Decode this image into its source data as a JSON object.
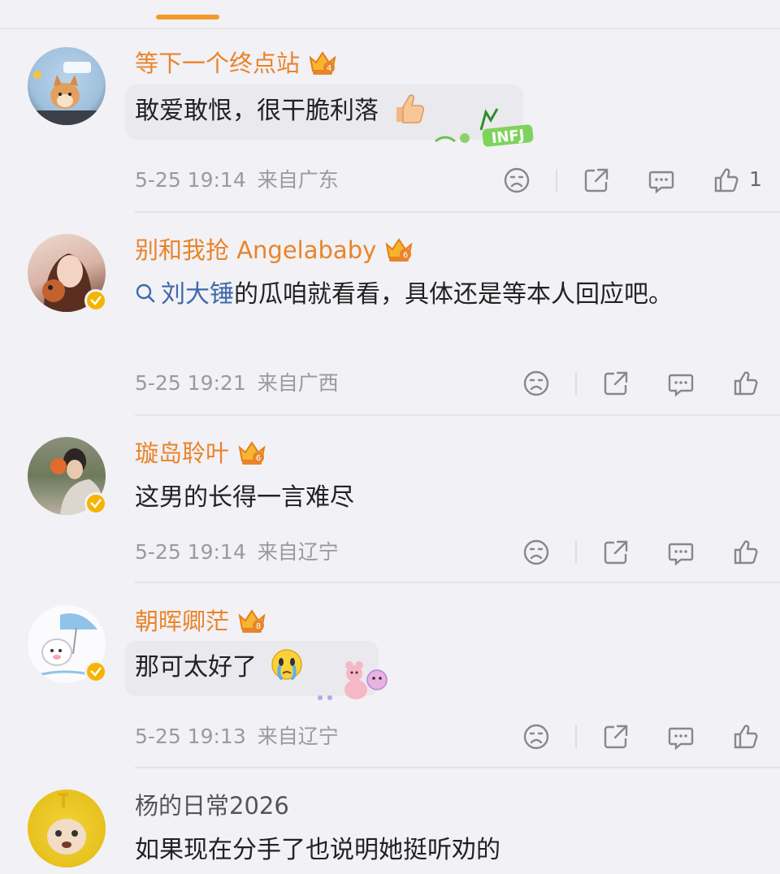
{
  "comments": [
    {
      "username": "等下一个终点站",
      "username_style": "vip",
      "crown_level": "4",
      "text": "敢爱敢恨，很干脆利落",
      "inline_emoji": "thumbs-up",
      "sticker_text": "INFJ",
      "time": "5-25 19:14",
      "location": "来自广东",
      "like_count": "1"
    },
    {
      "username": "别和我抢 Angelababy",
      "username_style": "vip",
      "crown_level": "6",
      "search_term": "刘大锤",
      "text": "的瓜咱就看看，具体还是等本人回应吧。",
      "time": "5-25 19:21",
      "location": "来自广西",
      "like_count": ""
    },
    {
      "username": "璇岛聆叶",
      "username_style": "vip",
      "crown_level": "6",
      "text": "这男的长得一言难尽",
      "time": "5-25 19:14",
      "location": "来自辽宁",
      "like_count": ""
    },
    {
      "username": "朝晖卿茫",
      "username_style": "vip",
      "crown_level": "8",
      "text": "那可太好了",
      "inline_emoji": "crying-face",
      "time": "5-25 19:13",
      "location": "来自辽宁",
      "like_count": ""
    },
    {
      "username": "杨的日常2026",
      "username_style": "plain",
      "text": "如果现在分手了也说明她挺听劝的"
    }
  ],
  "colors": {
    "background": "#f2f1f5",
    "vip_name": "#e9842a",
    "tab_indicator": "#f39a2b",
    "link": "#3f6aa8",
    "meta": "#9a9a9f",
    "verified": "#f5b400"
  },
  "icons": {
    "dislike": "sad-face-icon",
    "share": "share-icon",
    "comment": "comment-icon",
    "like": "thumbs-up-icon",
    "verified": "verified-badge-icon",
    "crown": "vip-crown-icon",
    "search": "search-icon"
  }
}
